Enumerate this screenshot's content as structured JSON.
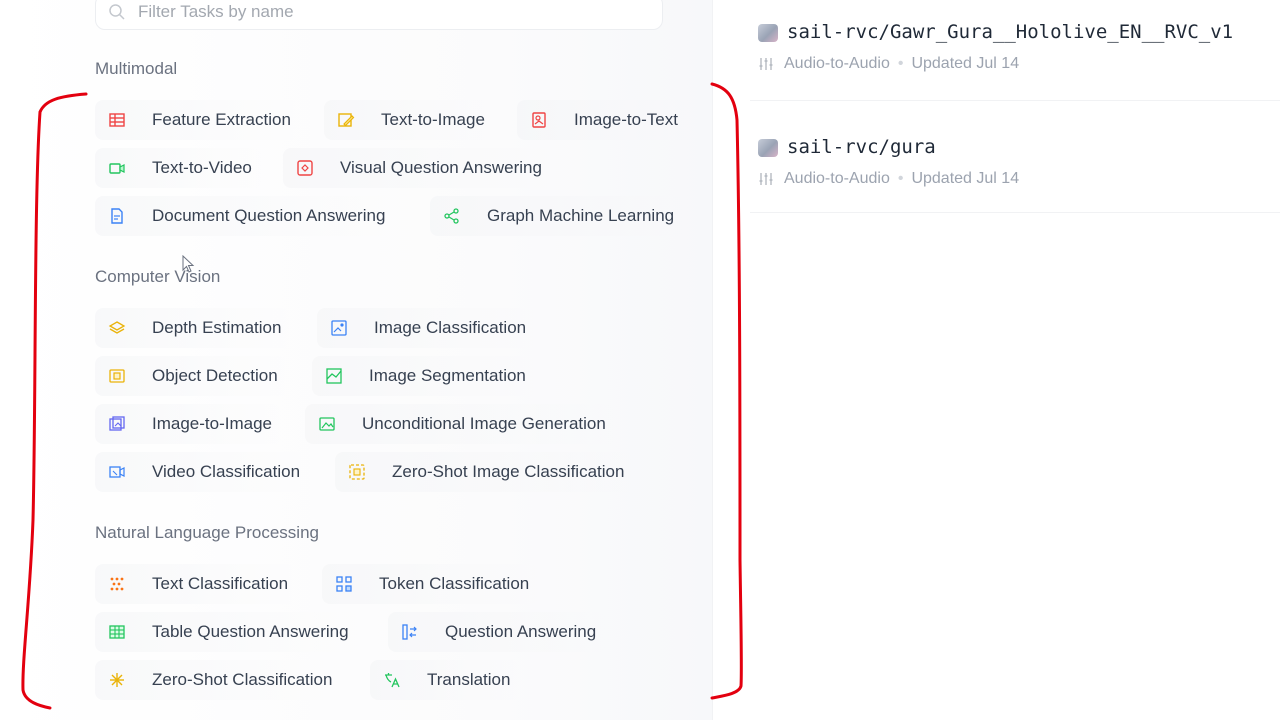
{
  "filter": {
    "placeholder": "Filter Tasks by name"
  },
  "sections": {
    "multimodal": {
      "title": "Multimodal",
      "items": [
        "Feature Extraction",
        "Text-to-Image",
        "Image-to-Text",
        "Text-to-Video",
        "Visual Question Answering",
        "Document Question Answering",
        "Graph Machine Learning"
      ]
    },
    "cv": {
      "title": "Computer Vision",
      "items": [
        "Depth Estimation",
        "Image Classification",
        "Object Detection",
        "Image Segmentation",
        "Image-to-Image",
        "Unconditional Image Generation",
        "Video Classification",
        "Zero-Shot Image Classification"
      ]
    },
    "nlp": {
      "title": "Natural Language Processing",
      "items": [
        "Text Classification",
        "Token Classification",
        "Table Question Answering",
        "Question Answering",
        "Zero-Shot Classification",
        "Translation"
      ]
    }
  },
  "models": [
    {
      "name": "sail-rvc/Gawr_Gura__Hololive_EN__RVC_v1",
      "task": "Audio-to-Audio",
      "sep": "•",
      "updated": "Updated Jul 14"
    },
    {
      "name": "sail-rvc/gura",
      "task": "Audio-to-Audio",
      "sep": "•",
      "updated": "Updated Jul 14"
    }
  ],
  "colors": {
    "annotation": "#e3000f",
    "accent_red": "#ef4444",
    "accent_yellow": "#eab308",
    "accent_green": "#22c55e",
    "accent_blue": "#3b82f6"
  }
}
